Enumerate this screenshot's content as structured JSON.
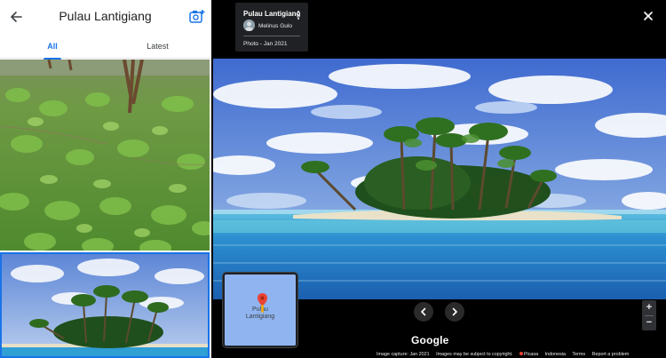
{
  "left_panel": {
    "title": "Pulau Lantigiang",
    "back_icon": "arrow-left-icon",
    "add_photo_icon": "add-photo-icon",
    "tabs": [
      {
        "label": "All",
        "selected": true
      },
      {
        "label": "Latest",
        "selected": false
      }
    ],
    "accent_color": "#1a73e8"
  },
  "viewer": {
    "info_card": {
      "title": "Pulau Lantigiang",
      "author": "Melinus Gulo",
      "date": "Photo - Jan 2021"
    },
    "minimap": {
      "label_line1": "Pulau",
      "label_line2": "Lantigiang"
    },
    "zoom_in_label": "+",
    "zoom_out_label": "−",
    "logo": "Google",
    "footer": {
      "capture": "Image capture: Jan 2021",
      "copyright": "Images may be subject to copyright.",
      "picasa": "Picasa",
      "language": "Indonesia",
      "terms": "Terms",
      "report": "Report a problem"
    }
  }
}
